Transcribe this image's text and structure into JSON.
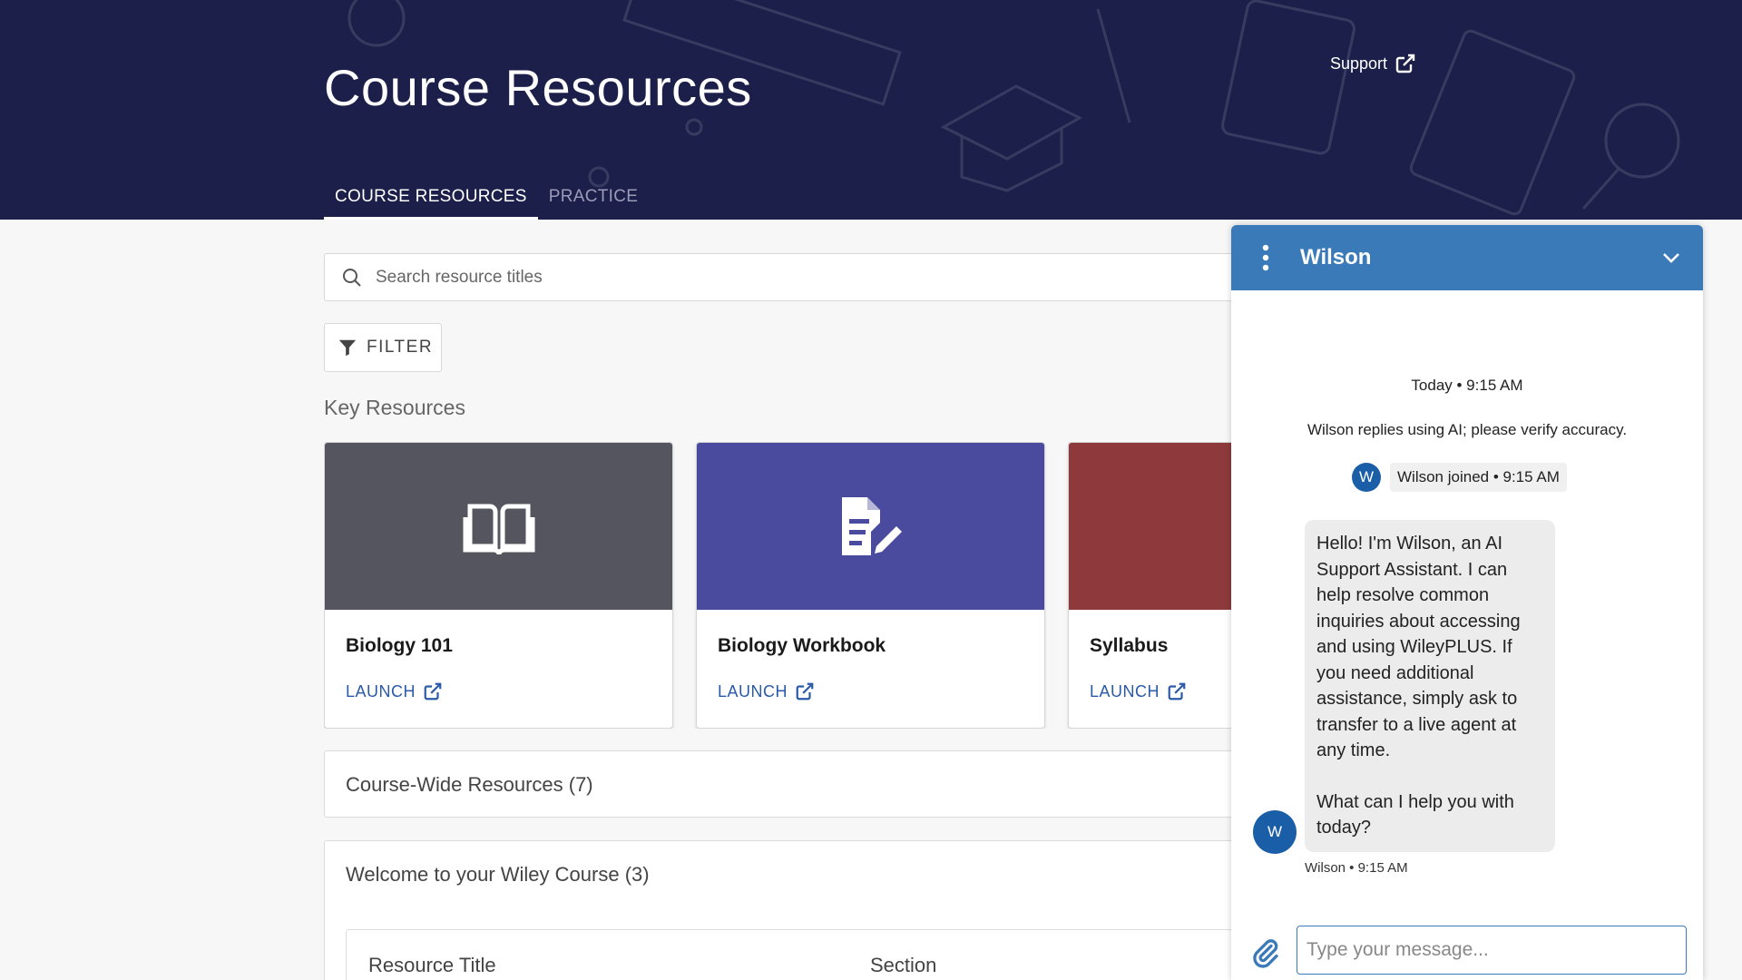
{
  "header": {
    "title": "Course Resources",
    "support_label": "Support",
    "tabs": [
      {
        "label": "COURSE RESOURCES",
        "active": true
      },
      {
        "label": "PRACTICE",
        "active": false
      }
    ]
  },
  "search": {
    "placeholder": "Search resource titles"
  },
  "filter": {
    "label": "FILTER"
  },
  "key_resources": {
    "title": "Key Resources",
    "cards": [
      {
        "name": "Biology 101",
        "launch_label": "LAUNCH",
        "icon": "book-open-icon",
        "color": "#54555f"
      },
      {
        "name": "Biology Workbook",
        "launch_label": "LAUNCH",
        "icon": "document-edit-icon",
        "color": "#4a4a9e"
      },
      {
        "name": "Syllabus",
        "launch_label": "LAUNCH",
        "icon": "pen-icon",
        "color": "#8e3a3c"
      }
    ]
  },
  "panels": {
    "course_wide": "Course-Wide Resources (7)",
    "welcome": "Welcome to your Wiley Course (3)"
  },
  "table": {
    "columns": [
      "Resource Title",
      "Section"
    ]
  },
  "chat": {
    "agent_name": "Wilson",
    "timestamp": "Today • 9:15 AM",
    "disclaimer": "Wilson replies using AI; please verify accuracy.",
    "joined_text": "Wilson joined • 9:15 AM",
    "avatar_letter": "W",
    "message_paragraphs": [
      "Hello! I'm Wilson, an AI Support Assistant. I can help resolve common inquiries about accessing and using WileyPLUS. If you need additional assistance, simply ask to transfer to a live agent at any time.",
      "What can I help you with today?"
    ],
    "sender_meta": "Wilson • 9:15 AM",
    "input_placeholder": "Type your message...",
    "accent_color": "#3a7ab8"
  }
}
